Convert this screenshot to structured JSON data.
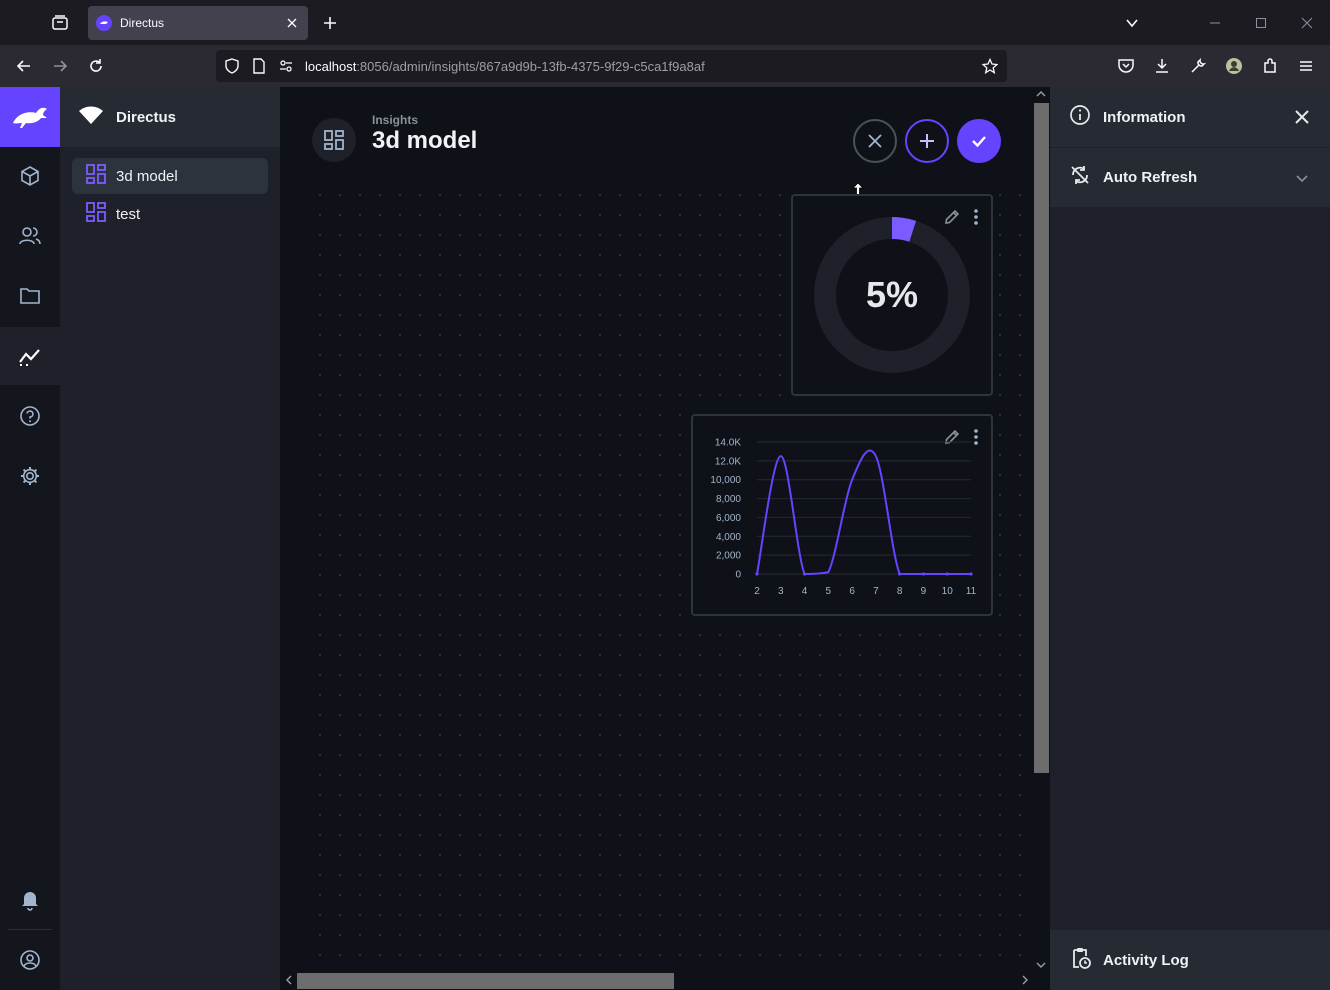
{
  "browser": {
    "tab_title": "Directus",
    "url_host": "localhost",
    "url_rest": ":8056/admin/insights/867a9d9b-13fb-4375-9f29-c5ca1f9a8af"
  },
  "project": {
    "name": "Directus"
  },
  "dashboards": [
    {
      "label": "3d model",
      "active": true
    },
    {
      "label": "test",
      "active": false
    }
  ],
  "header": {
    "breadcrumb": "Insights",
    "title": "3d model"
  },
  "meter": {
    "value_label": "5%",
    "value": 0.05,
    "color": "#6644ff"
  },
  "chart_data": {
    "type": "line",
    "x": [
      2,
      3,
      4,
      5,
      6,
      7,
      8,
      9,
      10,
      11
    ],
    "series": [
      {
        "values": [
          0,
          12500,
          0,
          200,
          10000,
          12500,
          0,
          0,
          0,
          0
        ]
      }
    ],
    "y_tick_labels": [
      "14.0K",
      "12.0K",
      "10,000",
      "8,000",
      "6,000",
      "4,000",
      "2,000",
      "0"
    ],
    "x_tick_labels": [
      "2",
      "3",
      "4",
      "5",
      "6",
      "7",
      "8",
      "9",
      "10",
      "11"
    ],
    "ylim": [
      0,
      14000
    ],
    "color": "#6644ff",
    "grid": true
  },
  "sidebar": {
    "information": "Information",
    "auto_refresh": "Auto Refresh",
    "activity_log": "Activity Log"
  },
  "colors": {
    "accent": "#6644ff",
    "background": "#0e1117",
    "panel": "#1e2129"
  }
}
